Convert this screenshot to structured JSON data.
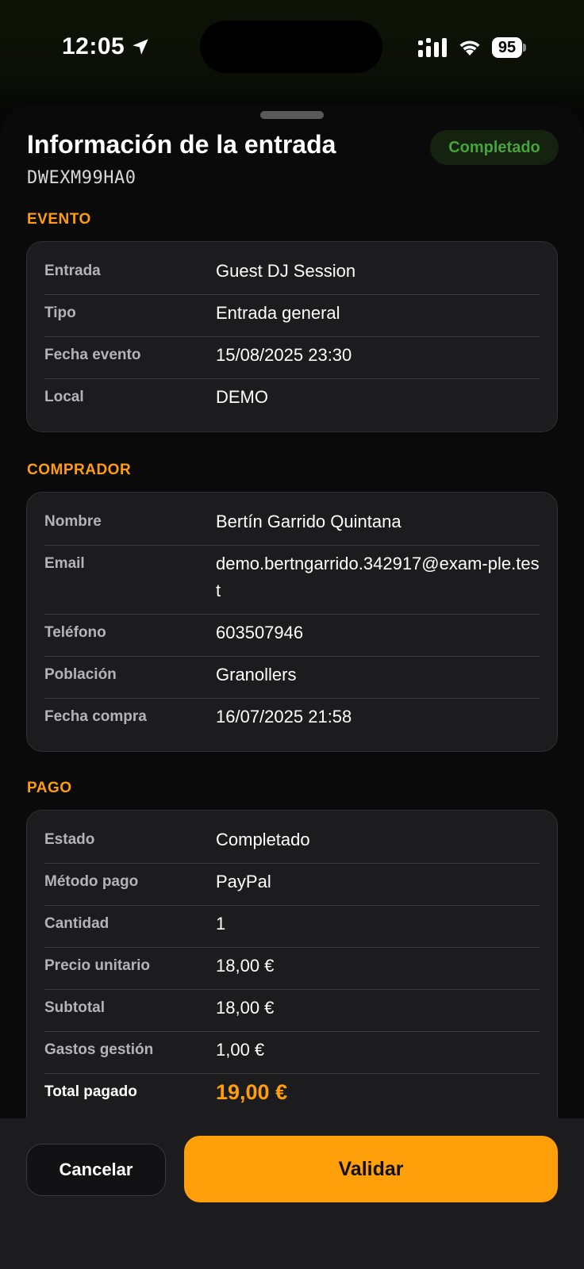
{
  "status_bar": {
    "time": "12:05",
    "battery": "95"
  },
  "sheet": {
    "title": "Información de la entrada",
    "code": "DWEXM99HA0",
    "status_badge": "Completado"
  },
  "sections": {
    "evento": {
      "label": "EVENTO",
      "rows": [
        {
          "label": "Entrada",
          "value": "Guest DJ Session"
        },
        {
          "label": "Tipo",
          "value": "Entrada general"
        },
        {
          "label": "Fecha evento",
          "value": "15/08/2025 23:30"
        },
        {
          "label": "Local",
          "value": "DEMO"
        }
      ]
    },
    "comprador": {
      "label": "COMPRADOR",
      "rows": [
        {
          "label": "Nombre",
          "value": "Bertín Garrido Quintana"
        },
        {
          "label": "Email",
          "value": "demo.bertngarrido.342917@exam-ple.test"
        },
        {
          "label": "Teléfono",
          "value": "603507946"
        },
        {
          "label": "Población",
          "value": "Granollers"
        },
        {
          "label": "Fecha compra",
          "value": "16/07/2025 21:58"
        }
      ]
    },
    "pago": {
      "label": "PAGO",
      "rows": [
        {
          "label": "Estado",
          "value": "Completado"
        },
        {
          "label": "Método pago",
          "value": "PayPal"
        },
        {
          "label": "Cantidad",
          "value": "1"
        },
        {
          "label": "Precio unitario",
          "value": "18,00 €"
        },
        {
          "label": "Subtotal",
          "value": "18,00 €"
        },
        {
          "label": "Gastos gestión",
          "value": "1,00 €"
        },
        {
          "label": "Total pagado",
          "value": "19,00 €"
        }
      ]
    }
  },
  "actions": {
    "cancel_label": "Cancelar",
    "validate_label": "Validar"
  },
  "colors": {
    "accent": "#ff9f0a",
    "success": "#46a43a",
    "card_bg": "#1c1c1e"
  }
}
